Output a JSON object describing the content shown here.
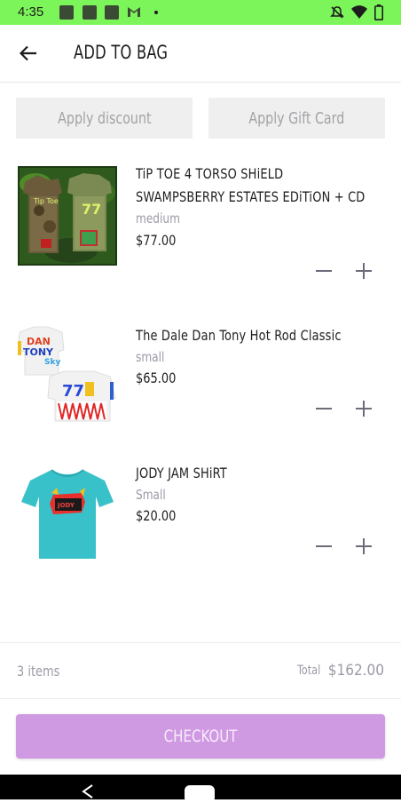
{
  "status_bar": {
    "time": "4:35",
    "icons": [
      "notification-icon",
      "notification-icon",
      "notification-icon",
      "gmail-icon",
      "dot-icon",
      "mute-icon",
      "wifi-icon",
      "battery-icon"
    ]
  },
  "app_bar": {
    "title": "ADD TO BAG",
    "back_icon": "arrow-left-icon"
  },
  "actions": {
    "discount_label": "Apply discount",
    "gift_card_label": "Apply Gift Card"
  },
  "cart": {
    "items": [
      {
        "name_line1": "TiP TOE 4 TORSO SHiELD",
        "name_line2": "SWAMPSBERRY ESTATES EDiTiON + CD",
        "size": "medium",
        "price": "$77.00",
        "image": "camo-shirts-image"
      },
      {
        "name_line1": "The Dale Dan Tony Hot Rod Classic",
        "size": "small",
        "price": "$65.00",
        "image": "white-racing-shirts-image"
      },
      {
        "name_line1": "JODY JAM SHiRT",
        "size": "Small",
        "price": "$20.00",
        "image": "teal-tshirt-image"
      }
    ]
  },
  "summary": {
    "item_count": "3 items",
    "total_label": "Total",
    "total_value": "$162.00"
  },
  "checkout_label": "CHECKOUT",
  "colors": {
    "status_bar": "#7cf55a",
    "checkout": "#d09ae3",
    "muted_text": "#9b9ba6",
    "button_bg": "#efeff0"
  }
}
